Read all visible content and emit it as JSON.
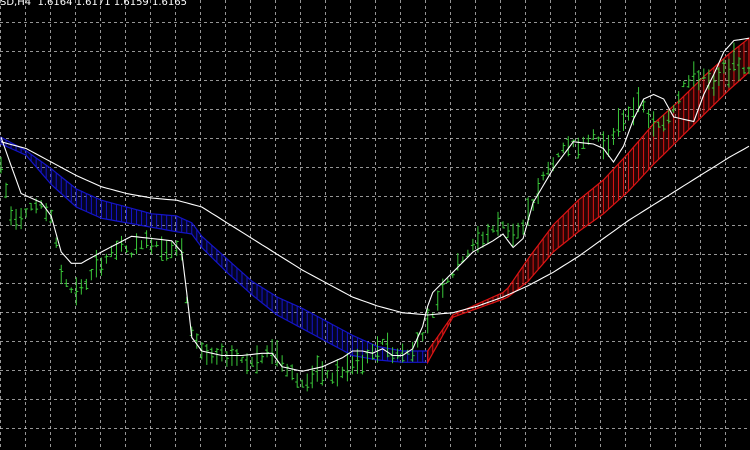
{
  "header": {
    "symbol": "SD,H4",
    "ohlc": "1.6164 1.6171 1.6159 1.6165"
  },
  "colors": {
    "background": "#000000",
    "grid": "#c8c8c8",
    "bars": "#39c739",
    "fast_line": "#ffffff",
    "slow_line": "#ffffff",
    "cloud_bearish": "#1414c8",
    "cloud_bullish": "#dc1414"
  },
  "chart_data": {
    "type": "line",
    "title": "",
    "xlabel": "",
    "ylabel": "",
    "grid": true,
    "legend": "none",
    "ylim": [
      1.5,
      1.7
    ],
    "x_count": 150,
    "price_bars": {
      "keys": [
        0,
        2,
        4,
        6,
        8,
        10,
        12,
        14,
        16,
        18,
        20,
        22,
        24,
        26,
        28,
        30,
        32,
        34,
        36,
        37,
        38,
        40,
        42,
        44,
        46,
        48,
        50,
        52,
        54,
        56,
        58,
        60,
        62,
        64,
        66,
        68,
        70,
        72,
        74,
        76,
        78,
        80,
        82,
        84,
        86,
        88,
        90,
        92,
        94,
        96,
        98,
        100,
        102,
        104,
        106,
        108,
        110,
        112,
        114,
        116,
        118,
        120,
        122,
        124,
        126,
        128,
        130,
        132,
        134,
        136,
        138,
        140,
        142,
        144,
        146,
        148,
        149
      ],
      "values": [
        1.626,
        1.604,
        1.604,
        1.608,
        1.608,
        1.604,
        1.578,
        1.571,
        1.571,
        1.577,
        1.583,
        1.587,
        1.59,
        1.587,
        1.592,
        1.592,
        1.591,
        1.589,
        1.588,
        1.566,
        1.553,
        1.544,
        1.54,
        1.541,
        1.542,
        1.54,
        1.539,
        1.54,
        1.545,
        1.539,
        1.534,
        1.529,
        1.532,
        1.534,
        1.532,
        1.534,
        1.537,
        1.538,
        1.542,
        1.548,
        1.543,
        1.542,
        1.545,
        1.551,
        1.56,
        1.573,
        1.578,
        1.585,
        1.59,
        1.594,
        1.598,
        1.6,
        1.596,
        1.598,
        1.609,
        1.621,
        1.628,
        1.633,
        1.637,
        1.635,
        1.64,
        1.636,
        1.638,
        1.647,
        1.653,
        1.652,
        1.643,
        1.645,
        1.652,
        1.663,
        1.664,
        1.667,
        1.66,
        1.669,
        1.671,
        1.669,
        1.668
      ],
      "range": [
        0.002,
        0.013
      ]
    },
    "series": [
      {
        "role": "fast",
        "keys": [
          0,
          4,
          8,
          10,
          12,
          14,
          16,
          20,
          26,
          30,
          34,
          36,
          37,
          38,
          40,
          44,
          48,
          52,
          54,
          56,
          60,
          62,
          64,
          68,
          70,
          72,
          74,
          76,
          78,
          80,
          82,
          84,
          85,
          86,
          90,
          94,
          98,
          100,
          102,
          104,
          106,
          110,
          114,
          118,
          120,
          122,
          124,
          126,
          128,
          130,
          132,
          134,
          138,
          140,
          142,
          144,
          146,
          149
        ],
        "values": [
          1.639,
          1.614,
          1.61,
          1.604,
          1.588,
          1.583,
          1.583,
          1.588,
          1.595,
          1.594,
          1.593,
          1.588,
          1.57,
          1.55,
          1.544,
          1.542,
          1.542,
          1.543,
          1.543,
          1.537,
          1.535,
          1.536,
          1.537,
          1.541,
          1.544,
          1.544,
          1.543,
          1.545,
          1.542,
          1.542,
          1.545,
          1.555,
          1.564,
          1.57,
          1.579,
          1.588,
          1.593,
          1.596,
          1.59,
          1.594,
          1.61,
          1.625,
          1.637,
          1.636,
          1.634,
          1.628,
          1.635,
          1.647,
          1.656,
          1.658,
          1.656,
          1.648,
          1.646,
          1.658,
          1.667,
          1.677,
          1.682,
          1.683
        ]
      },
      {
        "role": "slow",
        "keys": [
          0,
          5,
          10,
          15,
          20,
          25,
          30,
          35,
          40,
          45,
          50,
          55,
          60,
          65,
          70,
          75,
          80,
          85,
          90,
          95,
          100,
          105,
          110,
          115,
          120,
          125,
          130,
          135,
          140,
          145,
          149
        ],
        "values": [
          1.637,
          1.634,
          1.628,
          1.622,
          1.617,
          1.614,
          1.612,
          1.611,
          1.608,
          1.601,
          1.594,
          1.587,
          1.58,
          1.574,
          1.568,
          1.564,
          1.561,
          1.56,
          1.561,
          1.564,
          1.568,
          1.573,
          1.579,
          1.586,
          1.594,
          1.602,
          1.609,
          1.616,
          1.623,
          1.63,
          1.635
        ]
      }
    ],
    "cloud": {
      "keys": [
        0,
        5,
        10,
        15,
        20,
        25,
        30,
        35,
        38,
        40,
        45,
        50,
        55,
        60,
        65,
        70,
        75,
        80,
        85,
        90,
        95,
        100,
        101,
        105,
        110,
        115,
        120,
        125,
        130,
        135,
        140,
        145,
        149
      ],
      "upper": [
        1.639,
        1.633,
        1.625,
        1.616,
        1.611,
        1.608,
        1.605,
        1.604,
        1.601,
        1.595,
        1.585,
        1.575,
        1.568,
        1.563,
        1.557,
        1.551,
        1.546,
        1.544,
        1.544,
        1.56,
        1.565,
        1.57,
        1.572,
        1.585,
        1.6,
        1.611,
        1.62,
        1.632,
        1.645,
        1.655,
        1.666,
        1.676,
        1.683
      ],
      "lower": [
        1.636,
        1.631,
        1.618,
        1.608,
        1.603,
        1.601,
        1.599,
        1.597,
        1.596,
        1.59,
        1.579,
        1.569,
        1.56,
        1.554,
        1.548,
        1.542,
        1.54,
        1.539,
        1.539,
        1.559,
        1.563,
        1.567,
        1.568,
        1.575,
        1.588,
        1.597,
        1.605,
        1.615,
        1.627,
        1.638,
        1.649,
        1.66,
        1.668
      ],
      "bearish_until": 85
    }
  }
}
